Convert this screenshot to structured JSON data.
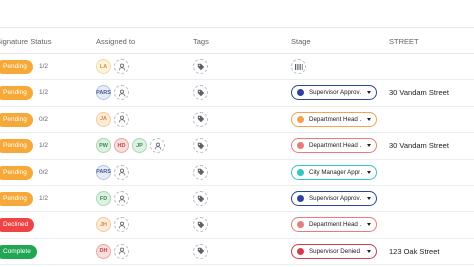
{
  "header": {
    "signature_status": "Signature Status",
    "assigned_to": "Assigned to",
    "tags": "Tags",
    "stage": "Stage",
    "street": "STREET"
  },
  "colors": {
    "pending": "#f6a938",
    "declined": "#ef4444",
    "complete": "#22a653"
  },
  "rows": [
    {
      "status": "Pending",
      "status_type": "pending",
      "count": "1/2",
      "avatars": [
        {
          "initials": "LA",
          "bg": "#fdf3dc",
          "fg": "#c99a42",
          "border": "#f2d9a4"
        }
      ],
      "stage": null,
      "street": ""
    },
    {
      "status": "Pending",
      "status_type": "pending",
      "count": "1/2",
      "avatars": [
        {
          "initials": "PARS",
          "bg": "#e6ecf7",
          "fg": "#4a5f96",
          "border": "#b7c4e3"
        }
      ],
      "stage": {
        "label": "Supervisor Approv…",
        "dot": "#2d4499",
        "border": "#2d4499"
      },
      "street": "30 Vandam Street"
    },
    {
      "status": "Pending",
      "status_type": "pending",
      "count": "0/2",
      "avatars": [
        {
          "initials": "JA",
          "bg": "#fdebd8",
          "fg": "#d08a46",
          "border": "#f4c999"
        }
      ],
      "stage": {
        "label": "Department Head …",
        "dot": "#f5a14d",
        "border": "#f5a14d"
      },
      "street": ""
    },
    {
      "status": "Pending",
      "status_type": "pending",
      "count": "1/2",
      "avatars": [
        {
          "initials": "PW",
          "bg": "#dff1e3",
          "fg": "#3f8a53",
          "border": "#a8d7b4"
        },
        {
          "initials": "HD",
          "bg": "#f9dede",
          "fg": "#b94747",
          "border": "#eca4a4"
        },
        {
          "initials": "JP",
          "bg": "#dff1e3",
          "fg": "#3f8a53",
          "border": "#a8d7b4"
        }
      ],
      "stage": {
        "label": "Department Head …",
        "dot": "#e77c7c",
        "border": "#e77c7c"
      },
      "street": "30 Vandam Street"
    },
    {
      "status": "Pending",
      "status_type": "pending",
      "count": "0/2",
      "avatars": [
        {
          "initials": "PARS",
          "bg": "#e6ecf7",
          "fg": "#4a5f96",
          "border": "#b7c4e3"
        }
      ],
      "stage": {
        "label": "City Manager Appr…",
        "dot": "#36c3c7",
        "border": "#36c3c7"
      },
      "street": ""
    },
    {
      "status": "Pending",
      "status_type": "pending",
      "count": "1/2",
      "avatars": [
        {
          "initials": "FD",
          "bg": "#dff1e3",
          "fg": "#3f8a53",
          "border": "#a8d7b4"
        }
      ],
      "stage": {
        "label": "Supervisor Approv…",
        "dot": "#2d4499",
        "border": "#2d4499"
      },
      "street": ""
    },
    {
      "status": "Declined",
      "status_type": "declined",
      "count": "",
      "avatars": [
        {
          "initials": "JH",
          "bg": "#fdebd8",
          "fg": "#d08a46",
          "border": "#f4c999"
        }
      ],
      "stage": {
        "label": "Department Head …",
        "dot": "#e77c7c",
        "border": "#e77c7c"
      },
      "street": ""
    },
    {
      "status": "Complete",
      "status_type": "complete",
      "count": "",
      "avatars": [
        {
          "initials": "DH",
          "bg": "#f9dede",
          "fg": "#b94747",
          "border": "#eca4a4"
        }
      ],
      "stage": {
        "label": "Supervisor Denied",
        "dot": "#d63a4f",
        "border": "#d63a4f"
      },
      "street": "123 Oak Street"
    }
  ]
}
